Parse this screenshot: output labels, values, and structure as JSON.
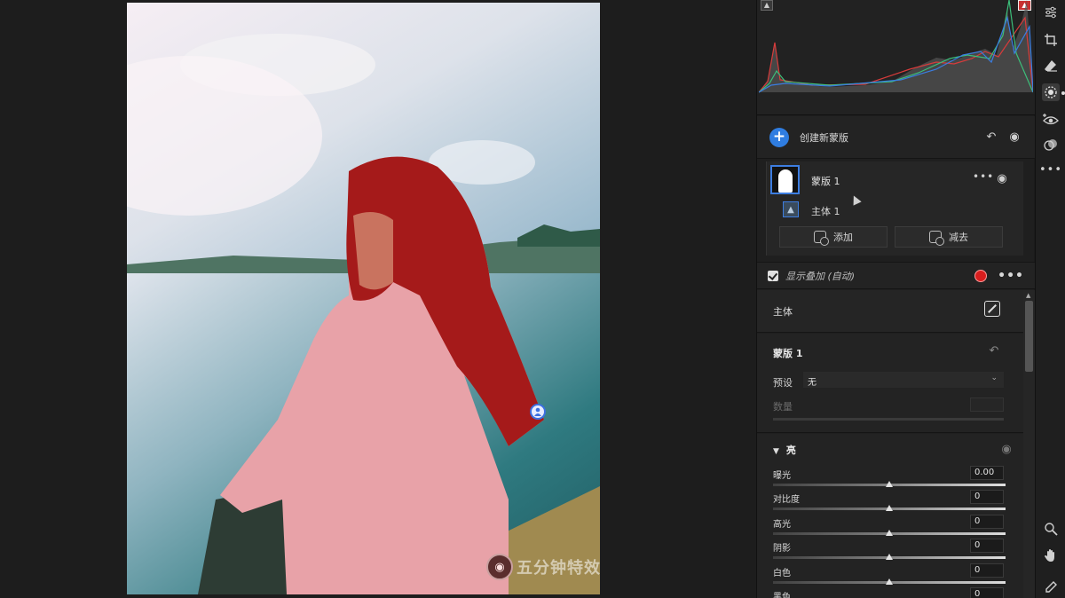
{
  "histogram": {
    "clip_shadows_icon": "shadow-clip-icon",
    "clip_highlights_icon": "highlight-clip-icon"
  },
  "masks": {
    "header_title": "创建新蒙版",
    "mask_name": "蒙版 1",
    "component_name": "主体 1",
    "add_label": "添加",
    "subtract_label": "减去"
  },
  "overlay": {
    "label": "显示叠加 (自动)",
    "color": "#d81e1e",
    "checked": true
  },
  "subject": {
    "label": "主体"
  },
  "mask1": {
    "title": "蒙版 1",
    "preset_label": "预设",
    "preset_value": "无",
    "amount_label": "数量"
  },
  "light": {
    "title": "亮",
    "sliders": [
      {
        "name": "曝光",
        "value": "0.00"
      },
      {
        "name": "对比度",
        "value": "0"
      },
      {
        "name": "高光",
        "value": "0"
      },
      {
        "name": "阴影",
        "value": "0"
      },
      {
        "name": "白色",
        "value": "0"
      },
      {
        "name": "黑色",
        "value": "0"
      }
    ]
  },
  "watermark": {
    "text": "五分钟特效"
  },
  "toolbar": {
    "tools": [
      "edit-sliders-icon",
      "crop-icon",
      "healing-eraser-icon",
      "masking-icon",
      "red-eye-icon",
      "presets-icon",
      "more-icon",
      "zoom-icon",
      "hand-icon",
      "eyedropper-icon"
    ],
    "active": "masking-icon"
  },
  "colors": {
    "accent": "#2f7de1",
    "overlay_red": "#d81e1e"
  }
}
